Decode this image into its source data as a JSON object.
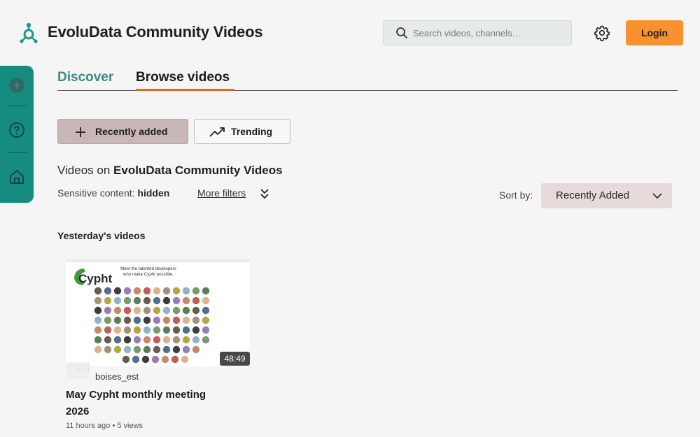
{
  "header": {
    "brand": "EvoluData Community Videos",
    "search_placeholder": "Search videos, channels…",
    "login_label": "Login"
  },
  "tabs": [
    {
      "label": "Discover",
      "active": false
    },
    {
      "label": "Browse videos",
      "active": true
    }
  ],
  "filters": {
    "recently_added": "Recently added",
    "trending": "Trending"
  },
  "list": {
    "videos_on_prefix": "Videos on ",
    "videos_on_name": "EvoluData Community Videos",
    "sensitive_label": "Sensitive content: ",
    "sensitive_value": "hidden",
    "more_filters": "More filters",
    "sort_label": "Sort by:",
    "sort_value": "Recently Added",
    "section_title": "Yesterday's videos"
  },
  "videos": [
    {
      "duration": "48:49",
      "channel": "boises_est",
      "title": "May Cypht monthly meeting 2026",
      "meta": "11 hours ago • 5 views",
      "thumb_heading_1": "Meet the talented developers",
      "thumb_heading_2": "who make Cypht possible.",
      "thumb_logo": "Cypht"
    }
  ],
  "colors": {
    "accent_teal": "#168b80",
    "login_orange": "#f7922e",
    "tab_underline": "#e06a1a"
  }
}
